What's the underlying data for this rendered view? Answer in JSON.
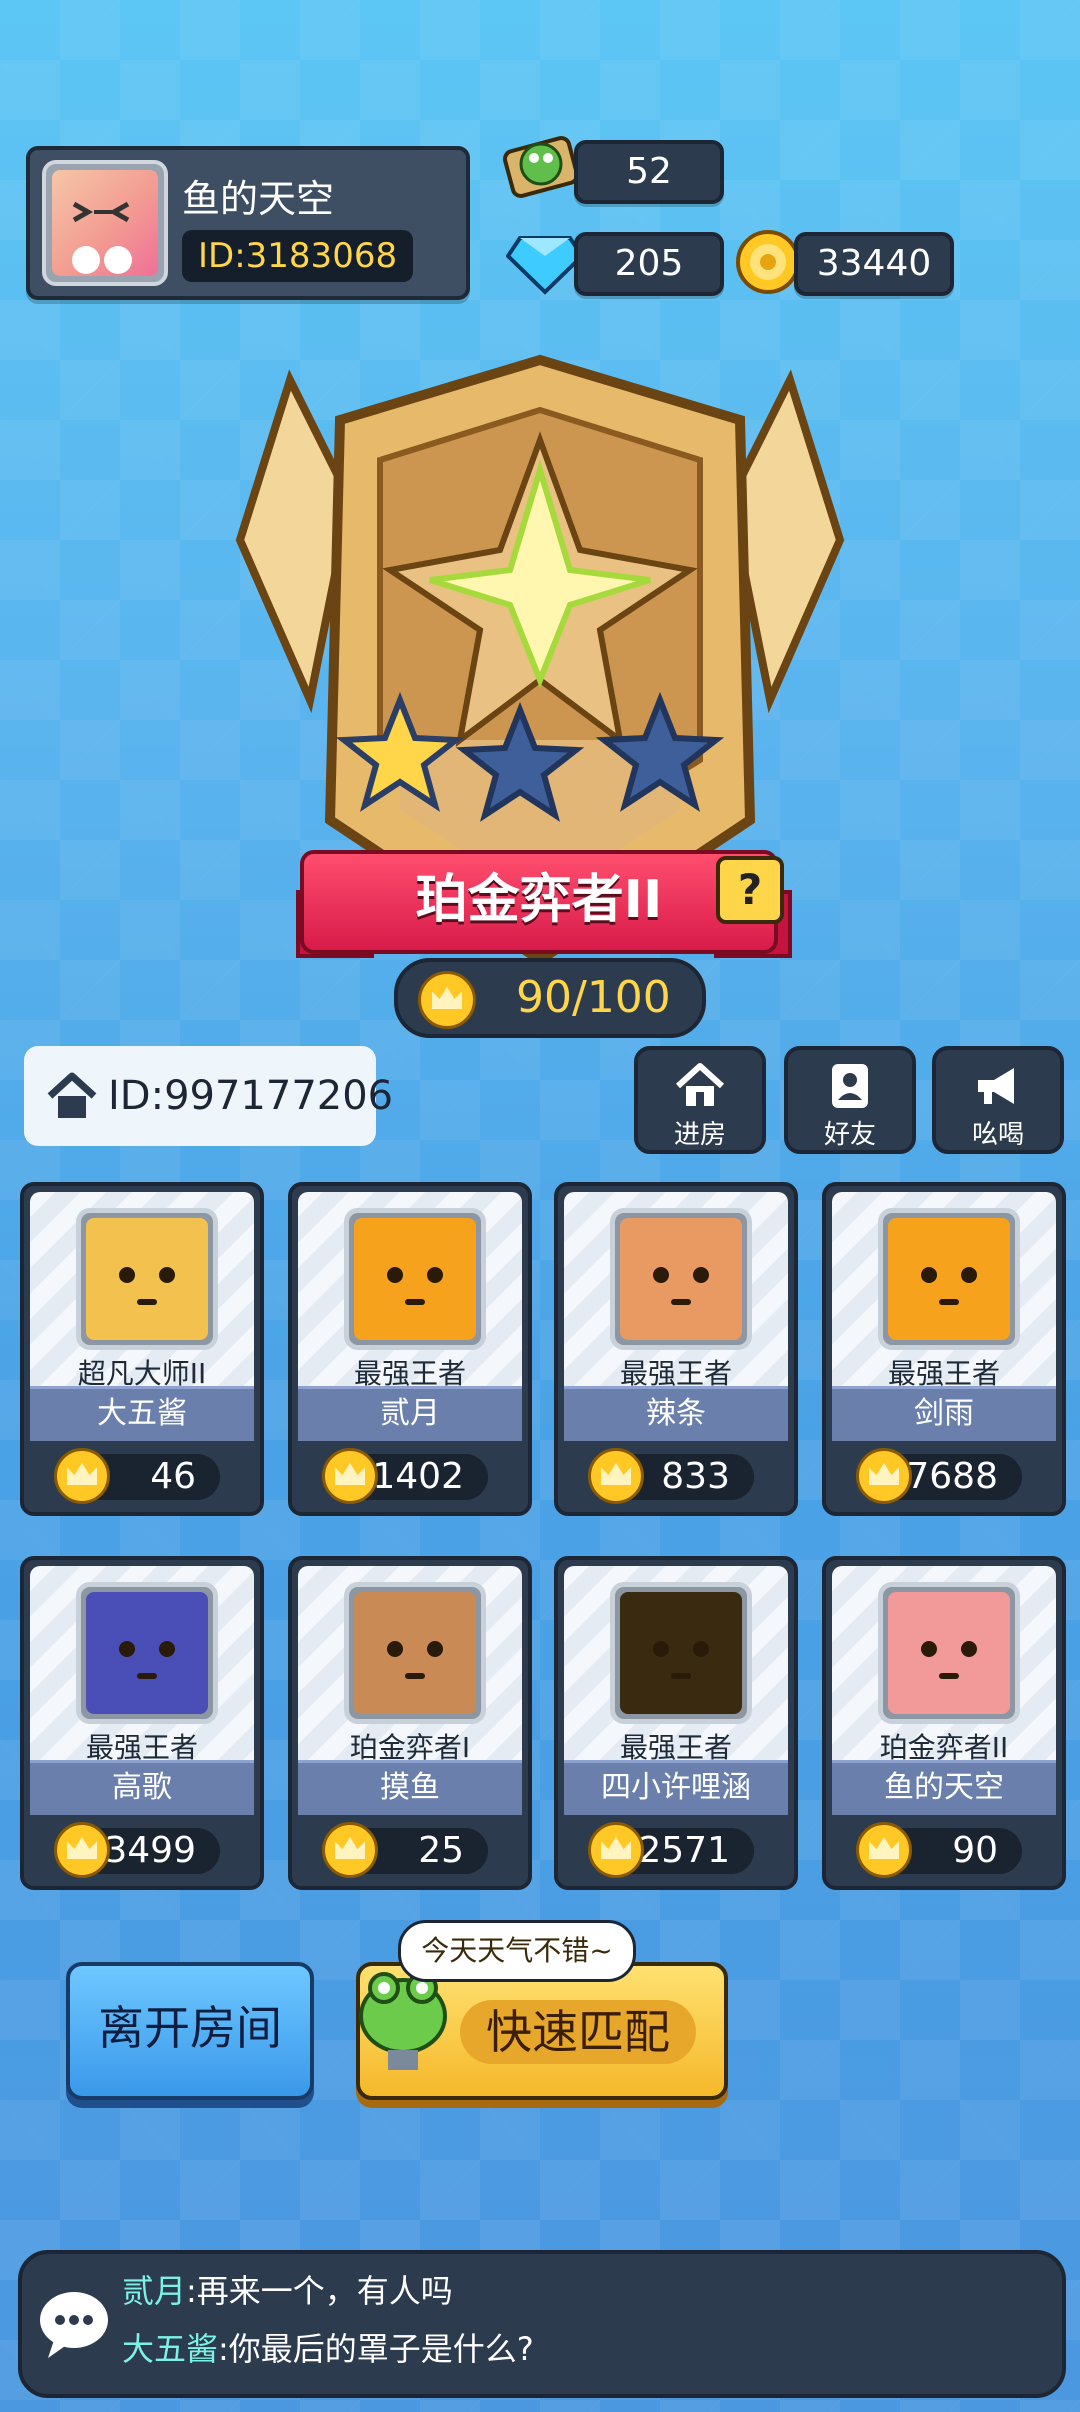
{
  "profile": {
    "name": "鱼的天空",
    "id": "ID:3183068"
  },
  "currency": {
    "tickets": "52",
    "gems": "205",
    "coins": "33440"
  },
  "rank": {
    "title": "珀金弈者II",
    "help": "?",
    "progress": "90/100",
    "stars_total": 3,
    "stars_filled": 1
  },
  "room": {
    "id": "ID:997177206"
  },
  "actions": [
    {
      "label": "进房",
      "icon": "home-icon"
    },
    {
      "label": "好友",
      "icon": "friends-icon"
    },
    {
      "label": "吆喝",
      "icon": "megaphone-icon"
    }
  ],
  "players": [
    {
      "title": "超凡大师II",
      "name": "大五酱",
      "score": "46",
      "face": "#f2c14e"
    },
    {
      "title": "最强王者",
      "name": "贰月",
      "score": "1402",
      "face": "#f7a21c"
    },
    {
      "title": "最强王者",
      "name": "辣条",
      "score": "833",
      "face": "#e99a62"
    },
    {
      "title": "最强王者",
      "name": "剑雨",
      "score": "7688",
      "face": "#f7a21c"
    },
    {
      "title": "最强王者",
      "name": "高歌",
      "score": "3499",
      "face": "#4a4fb8"
    },
    {
      "title": "珀金弈者I",
      "name": "摸鱼",
      "score": "25",
      "face": "#c98a55"
    },
    {
      "title": "最强王者",
      "name": "四小许哩涵",
      "score": "2571",
      "face": "#3a2a10"
    },
    {
      "title": "珀金弈者II",
      "name": "鱼的天空",
      "score": "90",
      "face": "#f29a9a"
    }
  ],
  "buttons": {
    "leave": "离开房间",
    "match": "快速匹配",
    "bubble": "今天天气不错~"
  },
  "chat": [
    {
      "who": "贰月",
      "text": ":再来一个，有人吗"
    },
    {
      "who": "大五酱",
      "text": ":你最后的罩子是什么?"
    }
  ]
}
